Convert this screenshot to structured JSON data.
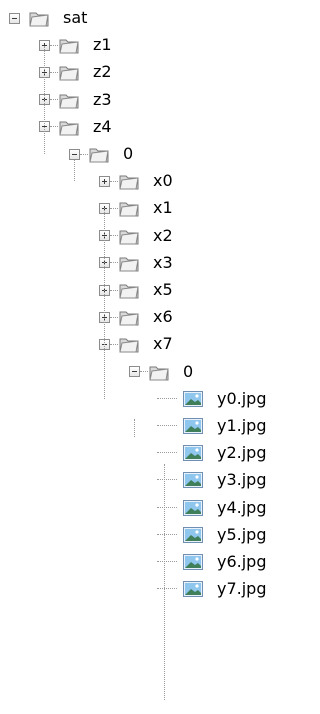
{
  "tree": [
    {
      "label": "sat",
      "icon": "folder-icon",
      "state": "expanded",
      "depth": 0
    },
    {
      "label": "z1",
      "icon": "folder-icon",
      "state": "collapsed",
      "depth": 1
    },
    {
      "label": "z2",
      "icon": "folder-icon",
      "state": "collapsed",
      "depth": 1
    },
    {
      "label": "z3",
      "icon": "folder-icon",
      "state": "collapsed",
      "depth": 1
    },
    {
      "label": "z4",
      "icon": "folder-icon",
      "state": "expanded",
      "depth": 1
    },
    {
      "label": "0",
      "icon": "folder-icon",
      "state": "expanded",
      "depth": 2
    },
    {
      "label": "x0",
      "icon": "folder-icon",
      "state": "collapsed",
      "depth": 3
    },
    {
      "label": "x1",
      "icon": "folder-icon",
      "state": "collapsed",
      "depth": 3
    },
    {
      "label": "x2",
      "icon": "folder-icon",
      "state": "collapsed",
      "depth": 3
    },
    {
      "label": "x3",
      "icon": "folder-icon",
      "state": "collapsed",
      "depth": 3
    },
    {
      "label": "x5",
      "icon": "folder-icon",
      "state": "collapsed",
      "depth": 3
    },
    {
      "label": "x6",
      "icon": "folder-icon",
      "state": "collapsed",
      "depth": 3
    },
    {
      "label": "x7",
      "icon": "folder-icon",
      "state": "expanded",
      "depth": 3
    },
    {
      "label": "0",
      "icon": "folder-icon",
      "state": "expanded",
      "depth": 4
    },
    {
      "label": "y0.jpg",
      "icon": "image-file-icon",
      "state": "leaf",
      "depth": 5
    },
    {
      "label": "y1.jpg",
      "icon": "image-file-icon",
      "state": "leaf",
      "depth": 5
    },
    {
      "label": "y2.jpg",
      "icon": "image-file-icon",
      "state": "leaf",
      "depth": 5
    },
    {
      "label": "y3.jpg",
      "icon": "image-file-icon",
      "state": "leaf",
      "depth": 5
    },
    {
      "label": "y4.jpg",
      "icon": "image-file-icon",
      "state": "leaf",
      "depth": 5
    },
    {
      "label": "y5.jpg",
      "icon": "image-file-icon",
      "state": "leaf",
      "depth": 5
    },
    {
      "label": "y6.jpg",
      "icon": "image-file-icon",
      "state": "leaf",
      "depth": 5
    },
    {
      "label": "y7.jpg",
      "icon": "image-file-icon",
      "state": "leaf",
      "depth": 5
    }
  ]
}
